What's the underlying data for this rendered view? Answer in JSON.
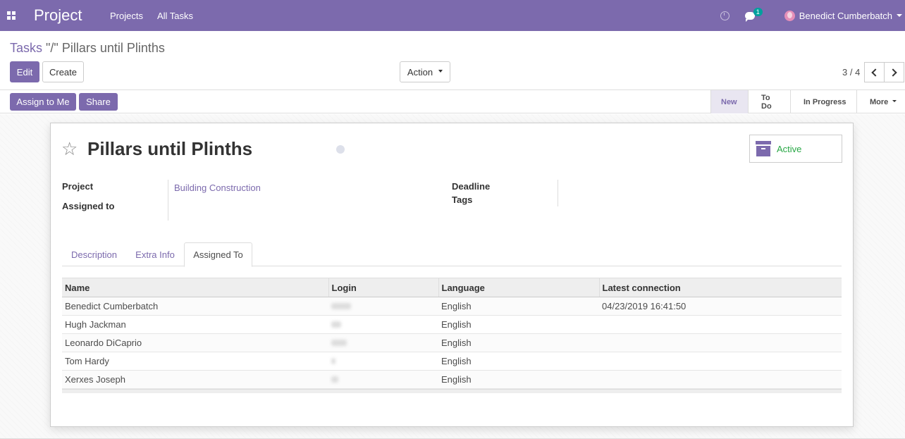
{
  "navbar": {
    "brand": "Project",
    "menu": [
      "Projects",
      "All Tasks"
    ],
    "chat_count": "1",
    "user_name": "Benedict Cumberbatch"
  },
  "breadcrumb": {
    "parent": "Tasks",
    "separator": " \"/\" ",
    "current": "Pillars until Plinths"
  },
  "toolbar": {
    "edit_label": "Edit",
    "create_label": "Create",
    "action_label": "Action",
    "pager": "3 / 4"
  },
  "statusbar": {
    "assign_label": "Assign to Me",
    "share_label": "Share",
    "stages": [
      "New",
      "To Do",
      "In Progress"
    ],
    "current_stage": "New",
    "more_label": "More"
  },
  "task": {
    "title": "Pillars until Plinths",
    "status_label": "Active",
    "fields": {
      "project_label": "Project",
      "project_value": "Building Construction",
      "assigned_label": "Assigned to",
      "deadline_label": "Deadline",
      "tags_label": "Tags"
    }
  },
  "tabs": [
    "Description",
    "Extra Info",
    "Assigned To"
  ],
  "active_tab": "Assigned To",
  "table": {
    "columns": [
      "Name",
      "Login",
      "Language",
      "Latest connection"
    ],
    "rows": [
      {
        "name": "Benedict Cumberbatch",
        "language": "English",
        "latest": "04/23/2019 16:41:50"
      },
      {
        "name": "Hugh Jackman",
        "language": "English",
        "latest": ""
      },
      {
        "name": "Leonardo DiCaprio",
        "language": "English",
        "latest": ""
      },
      {
        "name": "Tom Hardy",
        "language": "English",
        "latest": ""
      },
      {
        "name": "Xerxes Joseph",
        "language": "English",
        "latest": ""
      }
    ]
  },
  "colors": {
    "brand": "#7c6aad",
    "active_status": "#28a745"
  }
}
